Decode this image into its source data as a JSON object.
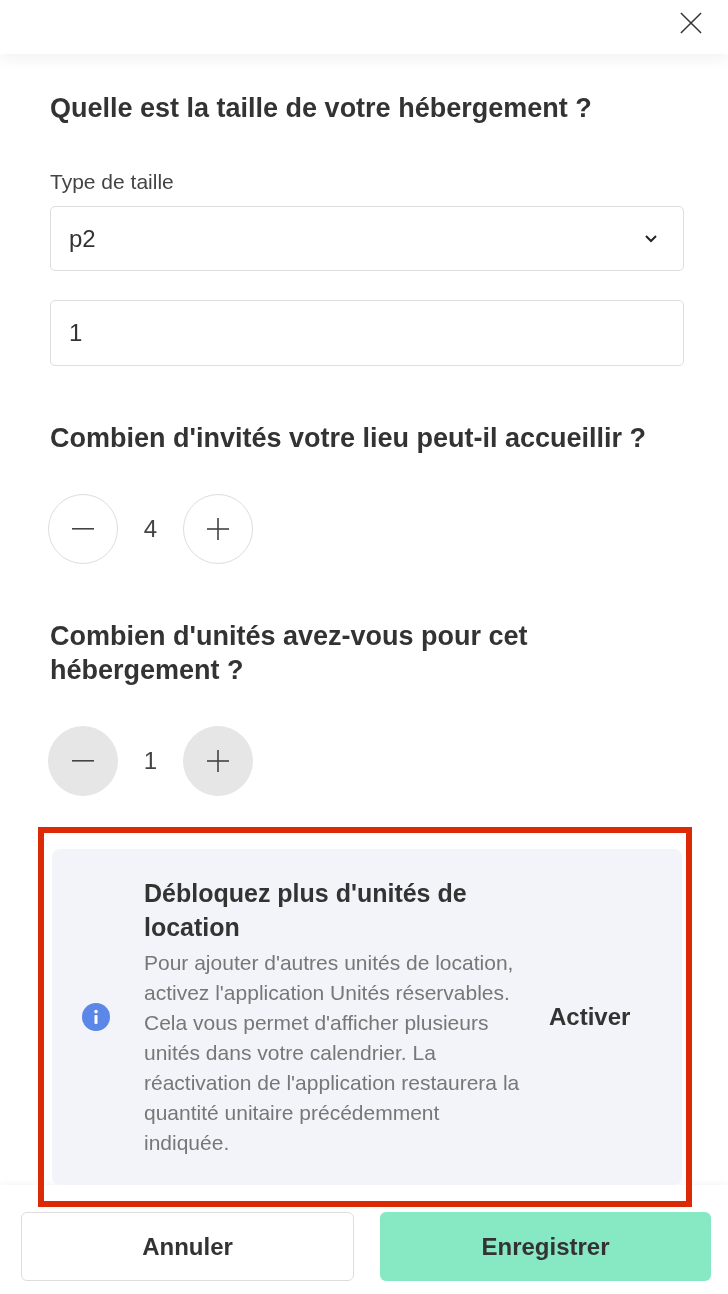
{
  "sections": [
    {
      "kind": "size",
      "title": "Quelle est la taille de votre hébergement ?",
      "select": {
        "label": "Type de taille",
        "value": "p2"
      },
      "input": {
        "value": "1"
      }
    },
    {
      "kind": "stepper",
      "title": "Combien d'invités votre lieu peut-il accueillir ?",
      "value": "4",
      "disabled": false
    },
    {
      "kind": "stepper",
      "title": "Combien d'unités avez-vous pour cet hébergement ?",
      "value": "1",
      "disabled": true
    }
  ],
  "notice": {
    "title": "Débloquez plus d'unités de location",
    "text": "Pour ajouter d'autres unités de location, activez l'application Unités réservables. Cela vous permet d'afficher plusieurs unités dans votre calendrier. La réactivation de l'application restaurera la quantité unitaire précédemment indiquée.",
    "action": "Activer",
    "highlighted": true
  },
  "buttons": [
    {
      "kind": "secondary",
      "label": "Annuler"
    },
    {
      "kind": "primary",
      "label": "Enregistrer"
    }
  ]
}
